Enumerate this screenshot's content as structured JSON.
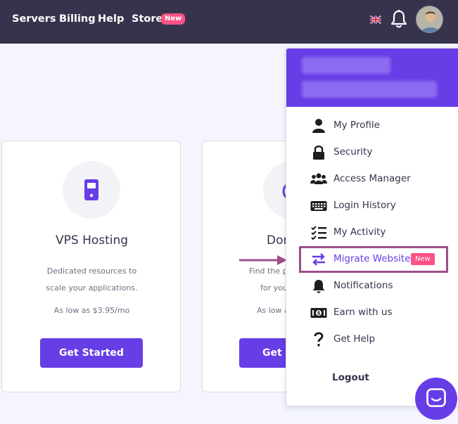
{
  "nav": {
    "items": [
      {
        "label": "Servers"
      },
      {
        "label": "Billing"
      },
      {
        "label": "Help"
      },
      {
        "label": "Store"
      }
    ],
    "store_badge": "New",
    "flag_icon": "uk-flag-icon",
    "bell_icon": "bell-icon"
  },
  "cards": [
    {
      "icon": "server-icon",
      "title": "VPS Hosting",
      "desc_line1": "Dedicated resources to",
      "desc_line2": "scale your applications.",
      "price": "As low as $3.95/mo",
      "button": "Get Started"
    },
    {
      "icon": "globe-icon",
      "title": "Dor",
      "desc_line1": "Find the p",
      "desc_line2": "for you",
      "price": "As low a",
      "button": "Get S"
    }
  ],
  "menu": {
    "items": [
      {
        "label": "My Profile",
        "icon": "user-icon"
      },
      {
        "label": "Security",
        "icon": "lock-icon"
      },
      {
        "label": "Access Manager",
        "icon": "users-icon"
      },
      {
        "label": "Login History",
        "icon": "keyboard-icon"
      },
      {
        "label": "My Activity",
        "icon": "checklist-icon"
      },
      {
        "label": "Migrate Website",
        "icon": "transfer-icon",
        "badge": "New"
      },
      {
        "label": "Notifications",
        "icon": "bell-icon"
      },
      {
        "label": "Earn with us",
        "icon": "money-icon"
      },
      {
        "label": "Get Help",
        "icon": "question-icon"
      }
    ],
    "logout": "Logout"
  },
  "colors": {
    "topbar": "#36344d",
    "accent": "#673de6",
    "badge": "#fc5185",
    "highlight_border": "#9d4d8b"
  }
}
